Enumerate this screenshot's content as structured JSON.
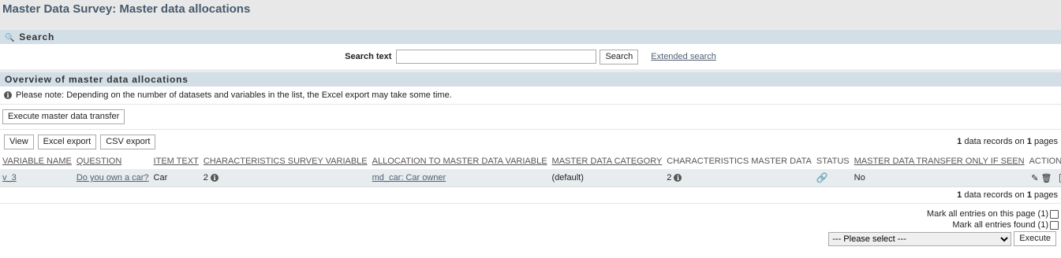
{
  "page": {
    "title": "Master Data Survey: Master data allocations"
  },
  "search": {
    "header": "Search",
    "label": "Search text",
    "value": "",
    "button": "Search",
    "extended_link": "Extended search"
  },
  "overview": {
    "header": "Overview of master data allocations",
    "note": "Please note: Depending on the number of datasets and variables in the list, the Excel export may take some time.",
    "transfer_button": "Execute master data transfer",
    "view_button": "View",
    "excel_button": "Excel export",
    "csv_button": "CSV export",
    "records_count": "1",
    "records_mid": "data records on",
    "records_pages": "1",
    "records_suffix": "pages"
  },
  "table": {
    "headers": [
      "VARIABLE NAME",
      "QUESTION",
      "ITEM TEXT",
      "CHARACTERISTICS SURVEY VARIABLE",
      "ALLOCATION TO MASTER DATA VARIABLE",
      "MASTER DATA CATEGORY",
      "CHARACTERISTICS MASTER DATA",
      "STATUS",
      "MASTER DATA TRANSFER ONLY IF SEEN",
      "ACTIONS"
    ],
    "row": {
      "variable_name": "v_3",
      "question": "Do you own a car?",
      "item_text": "Car",
      "char_survey": "2",
      "allocation": "md_car: Car owner",
      "category": "(default)",
      "char_master": "2",
      "transfer_if_seen": "No"
    }
  },
  "footer": {
    "mark_page": "Mark all entries on this page (1)",
    "mark_found": "Mark all entries found (1)",
    "select_value": "--- Please select ---",
    "execute_button": "Execute"
  },
  "colors": {
    "section_bg": "#d3dfe7",
    "title_color": "#465a6e",
    "row_bg": "#e7ecef",
    "status_green": "#3a9a3a"
  },
  "icons": [
    "search-icon",
    "info-icon",
    "link-icon",
    "pencil-icon",
    "trash-icon"
  ]
}
